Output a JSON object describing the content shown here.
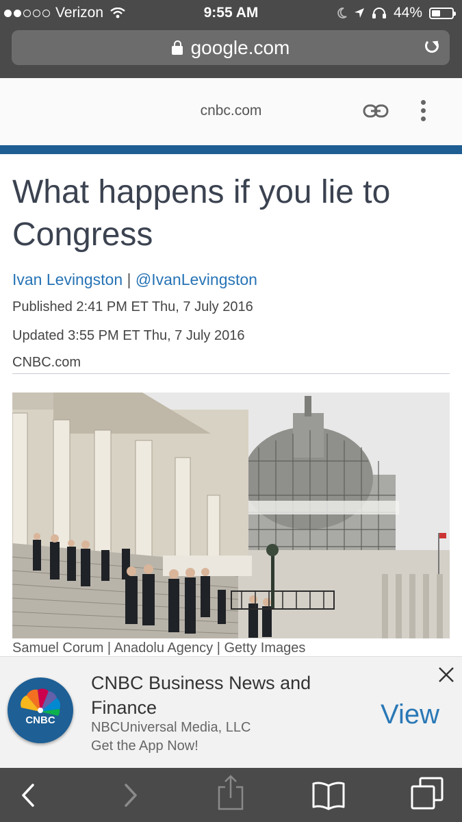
{
  "status": {
    "carrier": "Verizon",
    "time": "9:55 AM",
    "battery": "44%",
    "battery_level": 0.44,
    "signal_bars": 2
  },
  "browser": {
    "url": "google.com",
    "amp_domain": "cnbc.com"
  },
  "article": {
    "headline": "What happens if you lie to Congress",
    "author": "Ivan Levingston",
    "separator": "|",
    "handle": "@IvanLevingston",
    "published": "Published 2:41 PM ET Thu, 7 July 2016",
    "updated": "Updated 3:55 PM ET Thu, 7 July 2016",
    "source": "CNBC.com",
    "caption": "Samuel Corum | Anadolu Agency | Getty Images"
  },
  "app_banner": {
    "title": "CNBC Business News and Finance",
    "publisher": "NBCUniversal Media, LLC",
    "cta": "Get the App Now!",
    "view_label": "View",
    "logo_text": "CNBC"
  },
  "colors": {
    "chrome": "#4a4a4a",
    "accent_rule": "#1f5e92",
    "link": "#2673b5",
    "view": "#2a78b6"
  }
}
